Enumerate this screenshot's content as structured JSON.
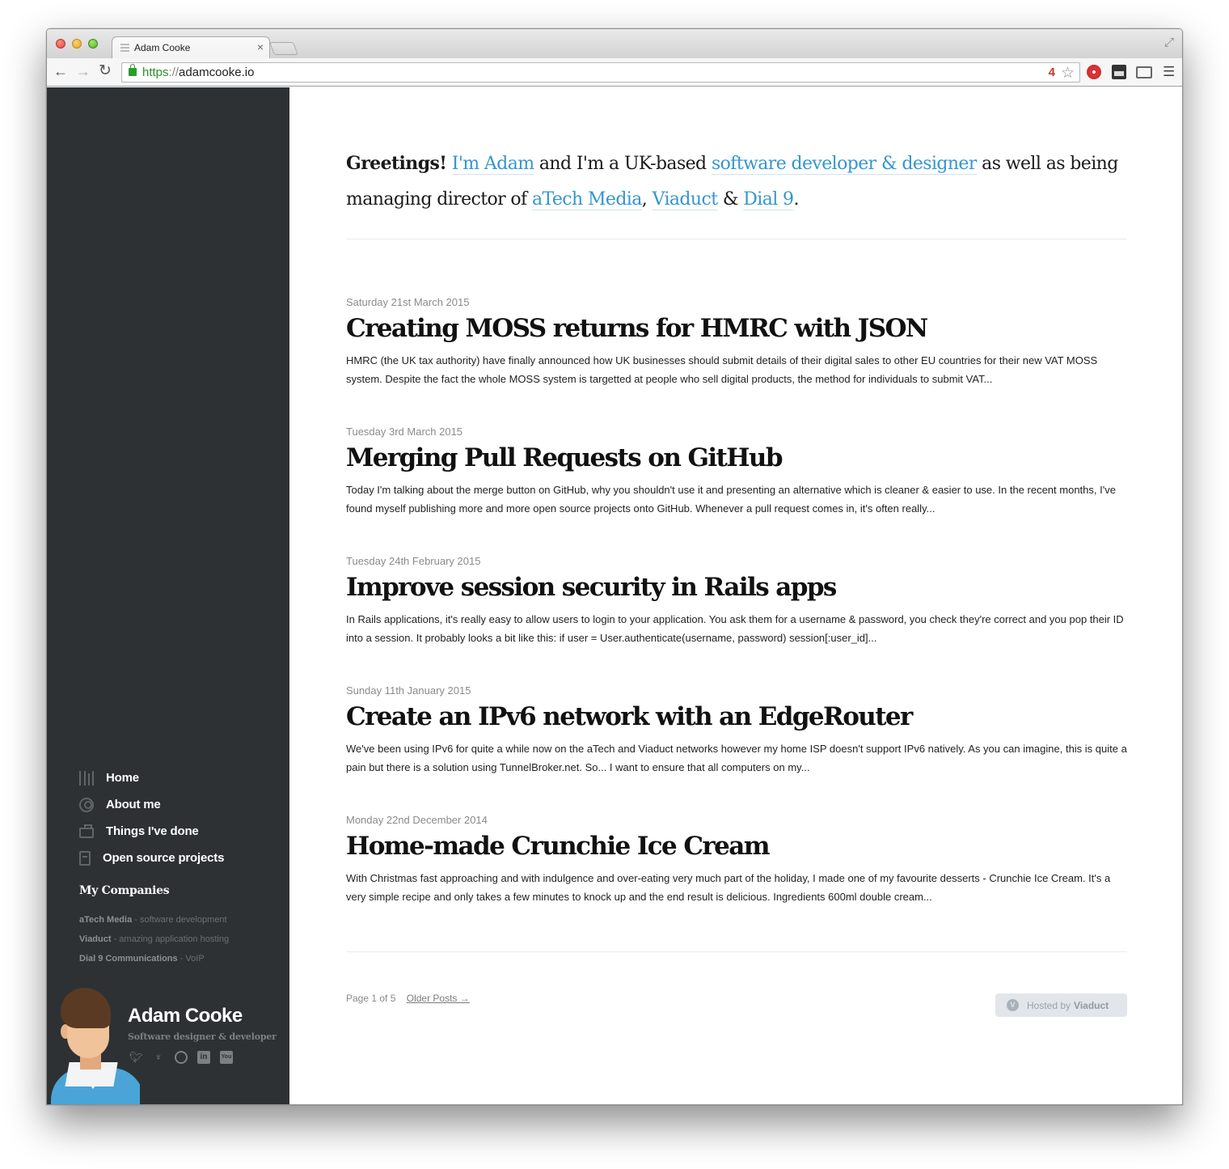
{
  "browser": {
    "tab_title": "Adam Cooke",
    "tab_close": "×",
    "url_scheme": "https",
    "url_sep": "://",
    "url_host": "adamcooke.io",
    "ext_badge": "4",
    "icons": [
      "back-arrow-icon",
      "forward-arrow-icon",
      "reload-icon",
      "lock-icon",
      "star-icon",
      "lastpass-icon",
      "readability-icon",
      "cast-icon",
      "menu-icon",
      "fullscreen-icon"
    ]
  },
  "sidebar": {
    "nav": [
      {
        "label": "Home",
        "icon": "books-icon"
      },
      {
        "label": "About me",
        "icon": "user-icon"
      },
      {
        "label": "Things I've done",
        "icon": "briefcase-icon"
      },
      {
        "label": "Open source projects",
        "icon": "code-icon"
      }
    ],
    "companies_title": "My Companies",
    "companies": [
      {
        "name": "aTech Media",
        "desc": " - software development"
      },
      {
        "name": "Viaduct",
        "desc": " - amazing application hosting"
      },
      {
        "name": "Dial 9 Communications",
        "desc": " - VoIP"
      }
    ],
    "profile": {
      "name": "Adam Cooke",
      "subtitle": "Software designer & developer",
      "social": [
        "twitter-icon",
        "github-icon",
        "dribbble-icon",
        "linkedin-icon",
        "youtube-icon"
      ],
      "linkedin_glyph": "in",
      "youtube_glyph": "You"
    }
  },
  "intro": {
    "greeting": "Greetings!",
    "link_me": "I'm Adam",
    "text1": " and I'm a UK-based ",
    "link_role": "software developer & designer",
    "text2": " as well as being managing director of ",
    "link_atech": "aTech Media",
    "comma": ", ",
    "link_viaduct": "Viaduct",
    "amp": " & ",
    "link_dial9": "Dial 9",
    "period": "."
  },
  "posts": [
    {
      "date": "Saturday 21st March 2015",
      "title": "Creating MOSS returns for HMRC with JSON",
      "excerpt": "HMRC (the UK tax authority) have finally announced how UK businesses should submit details of their digital sales to other EU countries for their new VAT MOSS system. Despite the fact the whole MOSS system is targetted at people who sell digital products, the method for individuals to submit VAT..."
    },
    {
      "date": "Tuesday 3rd March 2015",
      "title": "Merging Pull Requests on GitHub",
      "excerpt": "Today I'm talking about the merge button on GitHub, why you shouldn't use it and presenting an alternative which is cleaner & easier to use. In the recent months, I've found myself publishing more and more open source projects onto GitHub. Whenever a pull request comes in, it's often really..."
    },
    {
      "date": "Tuesday 24th February 2015",
      "title": "Improve session security in Rails apps",
      "excerpt": "In Rails applications, it's really easy to allow users to login to your application. You ask them for a username & password, you check they're correct and you pop their ID into a session. It probably looks a bit like this: if user = User.authenticate(username, password) session[:user_id]..."
    },
    {
      "date": "Sunday 11th January 2015",
      "title": "Create an IPv6 network with an EdgeRouter",
      "excerpt": "We've been using IPv6 for quite a while now on the aTech and Viaduct networks however my home ISP doesn't support IPv6 natively. As you can imagine, this is quite a pain but there is a solution using TunnelBroker.net. So... I want to ensure that all computers on my..."
    },
    {
      "date": "Monday 22nd December 2014",
      "title": "Home-made Crunchie Ice Cream",
      "excerpt": "With Christmas fast approaching and with indulgence and over-eating very much part of the holiday, I made one of my favourite desserts - Crunchie Ice Cream. It's a very simple recipe and only takes a few minutes to knock up and the end result is delicious. Ingredients 600ml double cream..."
    }
  ],
  "pagination": {
    "page_label": "Page 1 of 5",
    "older_label": "Older Posts →"
  },
  "hosted": {
    "prefix": "Hosted by",
    "brand": "Viaduct",
    "icon_glyph": "V"
  },
  "colors": {
    "sidebar_bg": "#2d3134",
    "link": "#3496cf",
    "text": "#1a1a1a",
    "muted": "#8b8b8b"
  }
}
